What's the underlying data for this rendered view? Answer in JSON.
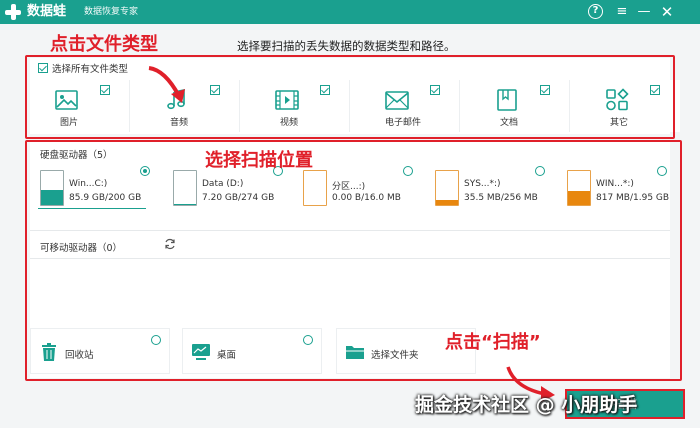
{
  "titlebar": {
    "app_name": "数据蛙",
    "app_subtitle": "数据恢复专家",
    "help_icon": "help-circle-icon",
    "menu_icon": "hamburger-menu-icon",
    "minimize_icon": "minimize-icon",
    "close_icon": "close-icon",
    "accent_color": "#1aa08f"
  },
  "instruction": "选择要扫描的丢失数据的数据类型和路径。",
  "annotations": {
    "click_file_type": "点击文件类型",
    "select_scan_location": "选择扫描位置",
    "click_scan": "点击“扫描”",
    "color": "#e0202a"
  },
  "file_types": {
    "select_all_label": "选择所有文件类型",
    "select_all_checked": true,
    "items": [
      {
        "label": "图片",
        "icon": "image-icon",
        "checked": true
      },
      {
        "label": "音频",
        "icon": "music-note-icon",
        "checked": true
      },
      {
        "label": "视频",
        "icon": "video-icon",
        "checked": true
      },
      {
        "label": "电子邮件",
        "icon": "mail-icon",
        "checked": true
      },
      {
        "label": "文档",
        "icon": "document-icon",
        "checked": true
      },
      {
        "label": "其它",
        "icon": "grid-shapes-icon",
        "checked": true
      }
    ]
  },
  "hard_drives": {
    "title": "硬盘驱动器（5）",
    "items": [
      {
        "name": "Win...C:)",
        "size": "85.9 GB/200 GB",
        "used_fraction": 0.43,
        "fill_color": "#1aa08f",
        "selected": true
      },
      {
        "name": "Data (D:)",
        "size": "7.20 GB/274 GB",
        "used_fraction": 0.03,
        "fill_color": "#1aa08f",
        "selected": false
      },
      {
        "name": "分区...:)",
        "size": "0.00  B/16.0 MB",
        "used_fraction": 0.0,
        "fill_color": "#e8870e",
        "selected": false
      },
      {
        "name": "SYS...*:)",
        "size": "35.5 MB/256 MB",
        "used_fraction": 0.14,
        "fill_color": "#e8870e",
        "selected": false
      },
      {
        "name": "WIN...*:)",
        "size": "817 MB/1.95 GB",
        "used_fraction": 0.42,
        "fill_color": "#e8870e",
        "selected": false
      }
    ]
  },
  "removable": {
    "title": "可移动驱动器（0）",
    "refresh_icon": "refresh-icon"
  },
  "locations": [
    {
      "label": "回收站",
      "icon": "trash-icon"
    },
    {
      "label": "桌面",
      "icon": "desktop-icon"
    },
    {
      "label": "选择文件夹",
      "icon": "folder-icon"
    }
  ],
  "scan_button": {
    "label": "扫描"
  },
  "watermark": "掘金技术社区 @ 小朋助手"
}
